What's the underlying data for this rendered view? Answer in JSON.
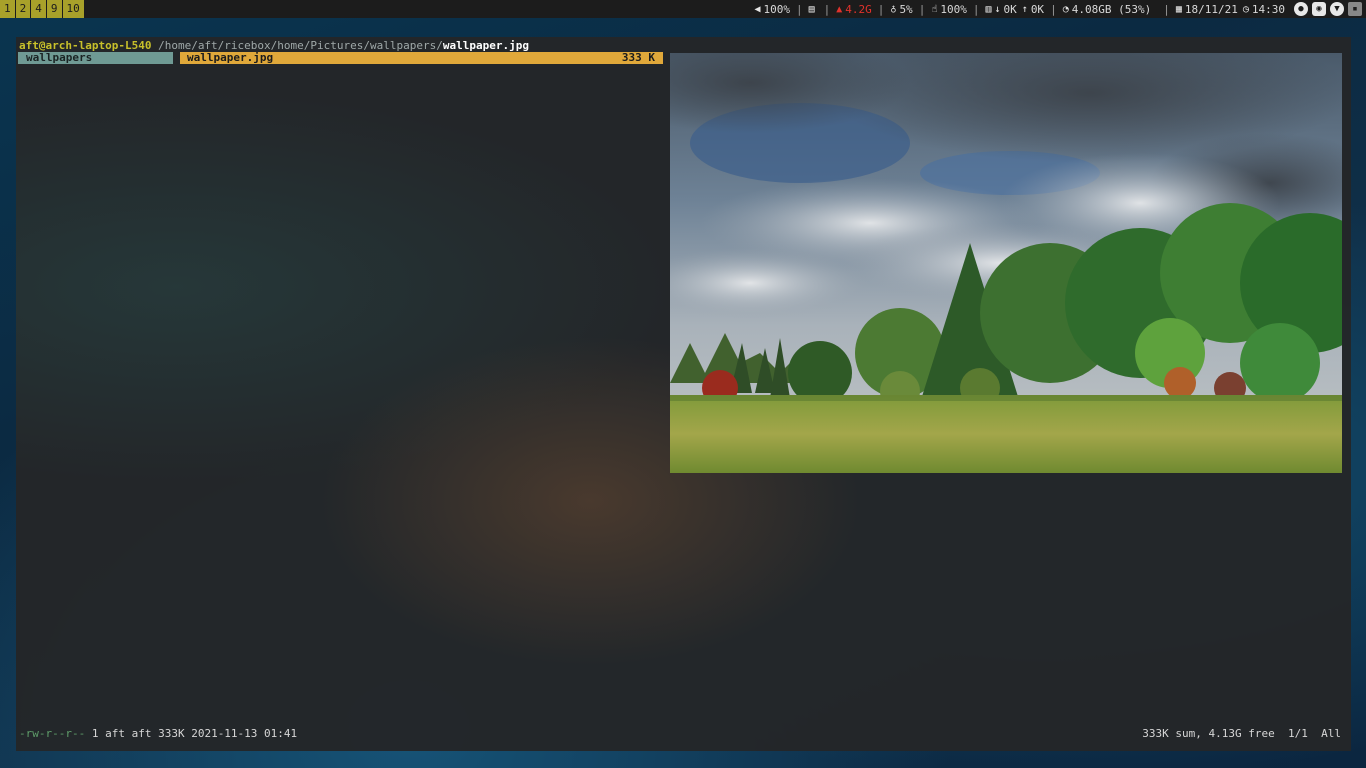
{
  "workspaces": [
    "1",
    "2",
    "4",
    "9",
    "10"
  ],
  "status": {
    "volume": "100%",
    "memory": "4.2G",
    "brightness": "5%",
    "battery": "100%",
    "net_down": "0K",
    "net_up": "0K",
    "disk": "4.08GB (53%)",
    "date": "18/11/21",
    "time": "14:30"
  },
  "colors": {
    "workspace_bg": "#a8a12a",
    "parent_highlight": "#6f9a94",
    "current_highlight": "#e0a83a",
    "host": "#c8c02a",
    "permissions": "#5f9e6a",
    "memory_alert": "#e0322c"
  },
  "icons": {
    "volume": "speaker-icon",
    "clipboard": "document-icon",
    "memory": "memory-icon",
    "brightness": "lightbulb-icon",
    "battery": "thumbs-up-icon",
    "network": "chart-icon",
    "disk": "pie-icon",
    "date": "calendar-icon",
    "time": "clock-icon"
  },
  "terminal": {
    "user_host": "aft@arch-laptop-L540",
    "path_dir": "/home/aft/ricebox/home/Pictures/wallpapers/",
    "path_file": "wallpaper.jpg",
    "parent_dir": "wallpapers",
    "current_file": "wallpaper.jpg",
    "current_size": "333 K",
    "file_permissions": "-rw-r--r--",
    "file_info": "1 aft aft 333K 2021-11-13 01:41",
    "summary": "333K sum, 4.13G free",
    "position": "1/1",
    "scroll": "All"
  }
}
